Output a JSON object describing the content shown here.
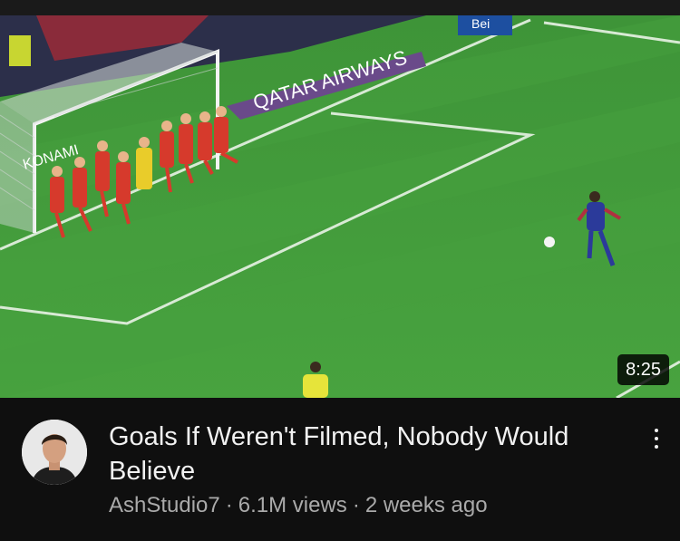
{
  "video": {
    "duration": "8:25",
    "title": "Goals If Weren't Filmed, Nobody Would Believe",
    "channel": "AshStudio7",
    "views": "6.1M views",
    "age": "2 weeks ago",
    "separator": "·",
    "thumbnail": {
      "sponsor_board": "QATAR AIRWAYS",
      "goal_board": "KONAMI",
      "top_banner": "Bei"
    }
  },
  "icons": {
    "more": "more-vert-icon"
  },
  "colors": {
    "background": "#0f0f0f",
    "title": "#f1f1f1",
    "meta": "#aaaaaa",
    "pitch": "#3f9a37"
  }
}
